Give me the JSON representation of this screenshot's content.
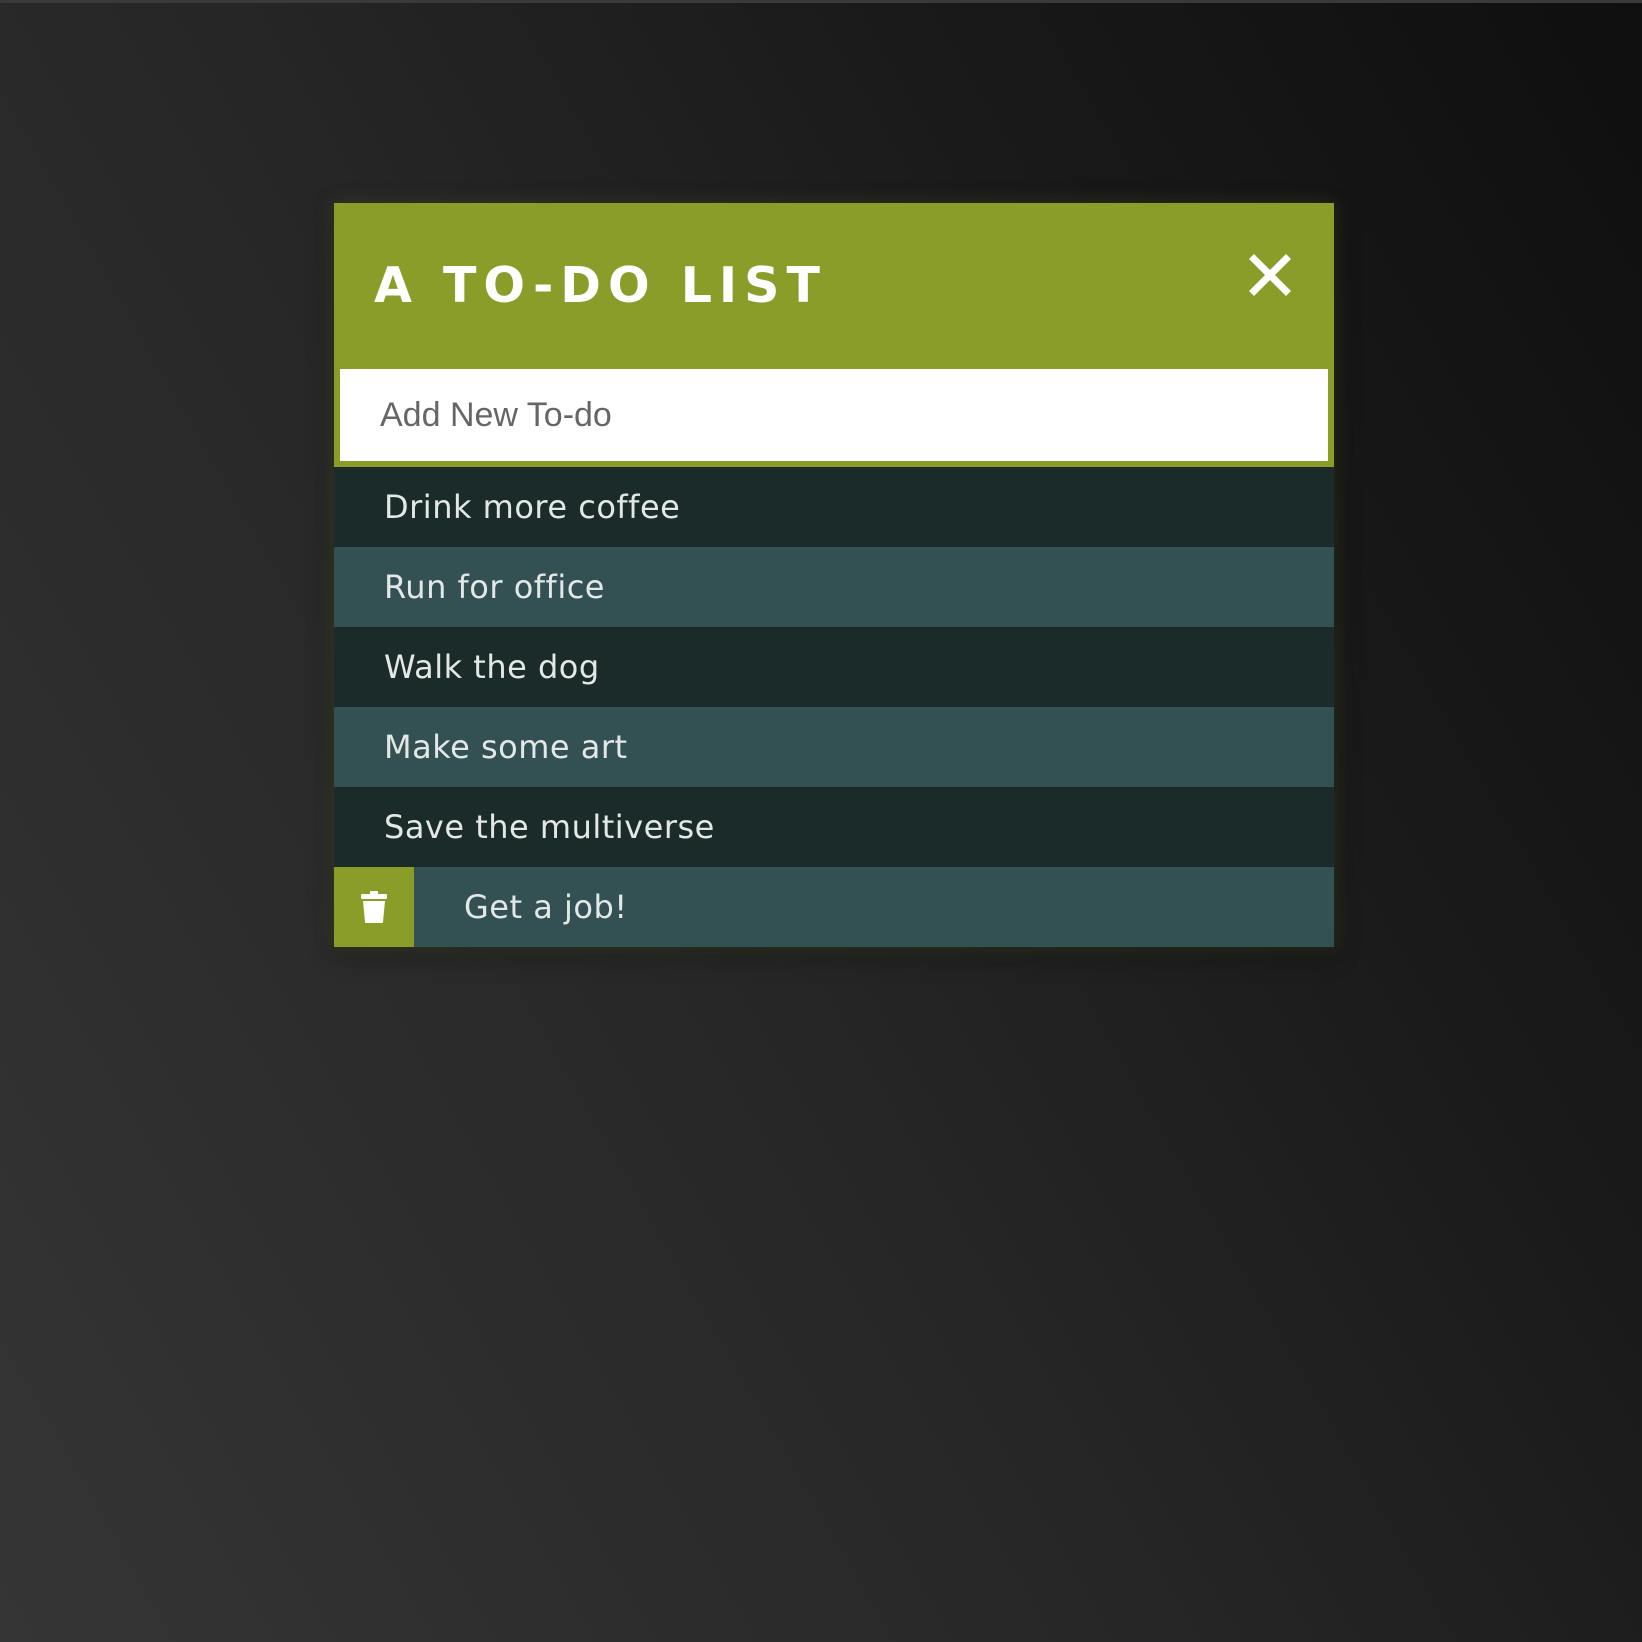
{
  "app": {
    "title": "A TO-DO LIST"
  },
  "input": {
    "placeholder": "Add New To-do",
    "value": ""
  },
  "todos": [
    {
      "text": "Drink more coffee",
      "shade": "dark"
    },
    {
      "text": "Run for office",
      "shade": "light"
    },
    {
      "text": "Walk the dog",
      "shade": "dark"
    },
    {
      "text": "Make some art",
      "shade": "light"
    },
    {
      "text": "Save the multiverse",
      "shade": "dark"
    },
    {
      "text": "Get a job!",
      "shade": "light",
      "hovered": true
    }
  ],
  "icons": {
    "close": "close-icon",
    "delete": "trash-icon"
  },
  "colors": {
    "accent": "#8a9d28",
    "row_dark": "#1b2b2a",
    "row_light": "#335152",
    "text": "#e3e8e6"
  }
}
